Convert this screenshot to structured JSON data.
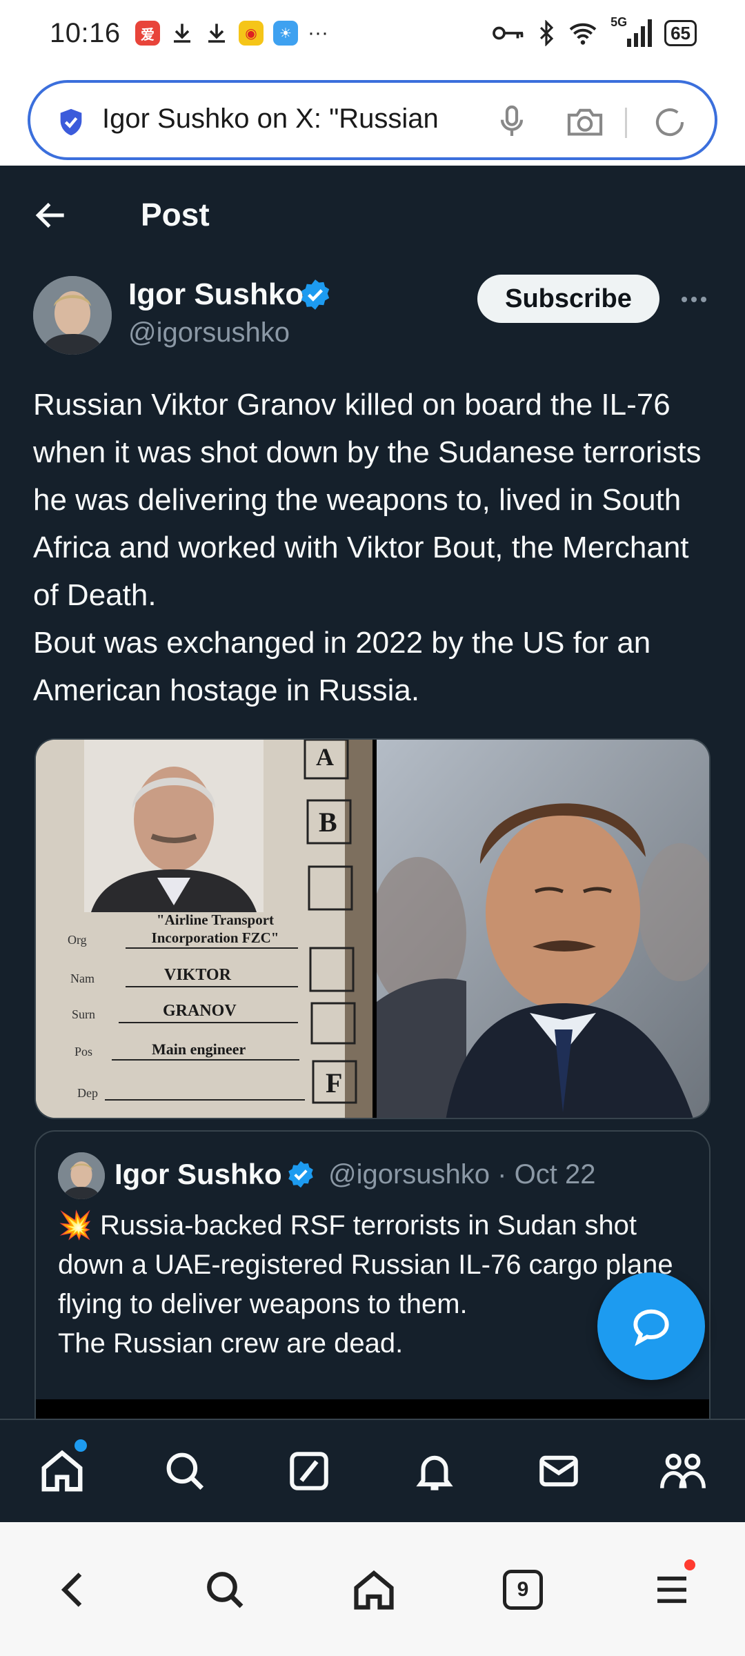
{
  "status_bar": {
    "time": "10:16",
    "battery": "65",
    "network": "5G",
    "overflow": "···"
  },
  "browser": {
    "url_text": "Igor Sushko on X: \"Russian",
    "tab_count": "9"
  },
  "header": {
    "title": "Post"
  },
  "post": {
    "author_name": "Igor Sushko",
    "author_handle": "@igorsushko",
    "subscribe_label": "Subscribe",
    "text_lines": [
      "Russian Viktor Granov killed on board the IL-76 when it was shot down by the Sudanese terrorists he was delivering the weapons to, lived in South Africa and worked with Viktor Bout, the Merchant of Death.",
      "Bout was exchanged in 2022 by the US for an American hostage in Russia."
    ],
    "image_left": {
      "header": "\"Airline Transport Incorporation FZC\"",
      "org_label": "Org",
      "name_label": "Nam",
      "name_value": "VIKTOR",
      "surname_label": "Surn",
      "surname_value": "GRANOV",
      "pos_label": "Pos",
      "pos_value": "Main engineer",
      "dep_label": "Dep",
      "box_a": "A",
      "box_b": "B",
      "box_f": "F"
    }
  },
  "quote": {
    "author_name": "Igor Sushko",
    "author_handle": "@igorsushko",
    "date": "· Oct 22",
    "emoji": "💥",
    "text_lines": [
      "Russia-backed RSF terrorists in Sudan shot down a UAE-registered Russian IL-76 cargo plane flying to deliver weapons to them.",
      "The Russian crew are dead."
    ]
  },
  "colors": {
    "background": "#15202b",
    "accent": "#1d9bf0",
    "text": "#f7f9f9",
    "muted": "#8b98a5",
    "border": "#38444d"
  },
  "icons": {
    "tabbar": [
      "home-icon",
      "search-icon",
      "grok-icon",
      "bell-icon",
      "mail-icon",
      "communities-icon"
    ],
    "browser_nav": [
      "back-icon",
      "search-icon",
      "home-icon",
      "tabs-icon",
      "menu-icon"
    ]
  }
}
